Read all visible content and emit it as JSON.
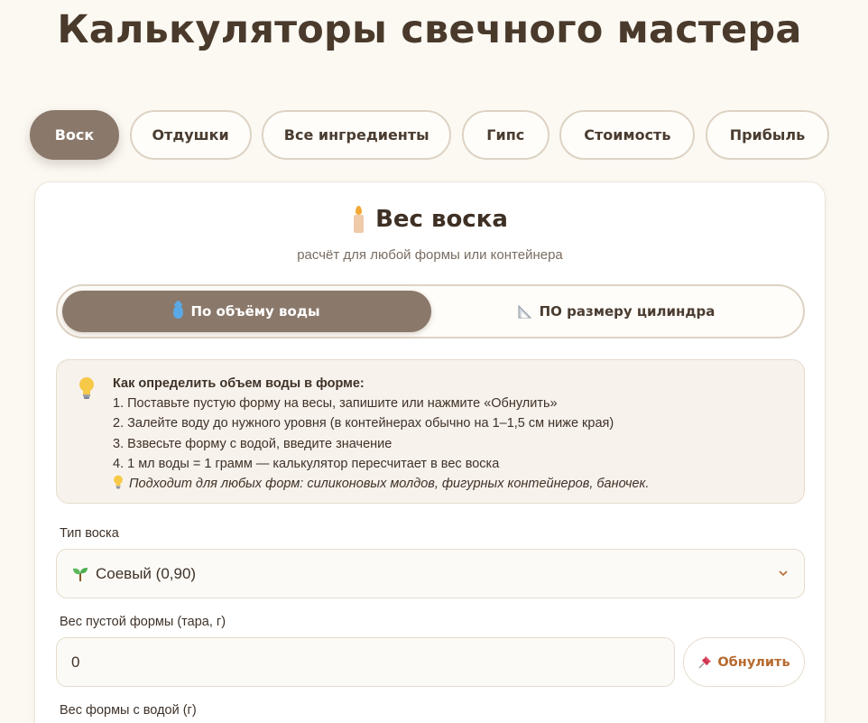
{
  "page": {
    "title": "Калькуляторы свечного мастера"
  },
  "tabs": [
    {
      "label": "Воск",
      "active": true
    },
    {
      "label": "Отдушки",
      "active": false
    },
    {
      "label": "Все ингредиенты",
      "active": false
    },
    {
      "label": "Гипс",
      "active": false
    },
    {
      "label": "Стоимость",
      "active": false
    },
    {
      "label": "Прибыль",
      "active": false
    }
  ],
  "calculator": {
    "icon": "candle-icon",
    "title": "Вес воска",
    "subtitle": "расчёт для любой формы или контейнера",
    "modes": {
      "water": {
        "label": "По объёму воды",
        "icon": "water-drop-icon",
        "active": true
      },
      "cylinder": {
        "label": "ПО размеру цилиндра",
        "icon": "ruler-icon",
        "active": false
      }
    },
    "info": {
      "icon": "lightbulb-icon",
      "heading": "Как определить объем воды в форме:",
      "steps": [
        "1. Поставьте пустую форму на весы, запишите или нажмите «Обнулить»",
        "2. Залейте воду до нужного уровня (в контейнерах обычно на 1–1,5 см ниже края)",
        "3. Взвесьте форму с водой, введите значение",
        "4. 1 мл воды = 1 грамм — калькулятор пересчитает в вес воска"
      ],
      "note": "Подходит для любых форм: силиконовых молдов, фигурных контейнеров, баночек."
    },
    "wax_type": {
      "label": "Тип воска",
      "selected": "Соевый (0,90)",
      "icon": "sprout-icon"
    },
    "tare": {
      "label": "Вес пустой формы (тара, г)",
      "value": "0"
    },
    "reset_button": {
      "label": "Обнулить",
      "icon": "pushpin-icon"
    },
    "filled": {
      "label": "Вес формы с водой (г)"
    }
  },
  "colors": {
    "accent": "#8a786a",
    "background": "#fcf9f3",
    "reset_text": "#b76a2e"
  }
}
